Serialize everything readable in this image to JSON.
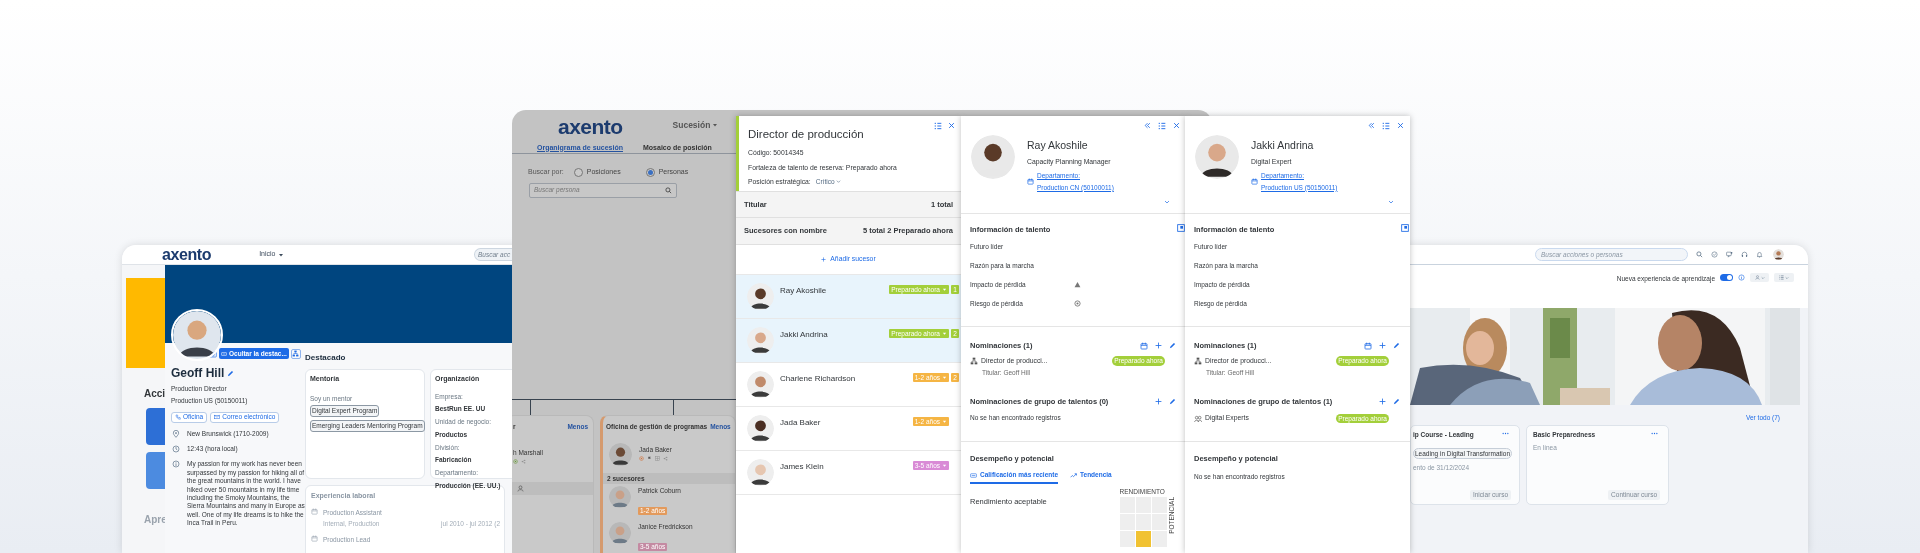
{
  "profile_window": {
    "logo": "axento",
    "nav_menu": "Inicio",
    "search_placeholder": "Buscar acc",
    "side_headings": [
      "Acci",
      "Apre"
    ],
    "profile": {
      "name": "Geoff Hill",
      "title": "Production Director",
      "org": "Production US (50150011)",
      "highlight_button": "Ocultar la destac...",
      "contact_buttons": [
        {
          "kind": "phone",
          "label": "Oficina"
        },
        {
          "kind": "mail",
          "label": "Correo electrónico"
        }
      ],
      "details": [
        {
          "kind": "location",
          "text": "New Brunswick (1710-2009)"
        },
        {
          "kind": "clock",
          "text": "12:43 (hora local)"
        },
        {
          "kind": "info",
          "text": "My passion for my work has never been surpassed by my passion for hiking all of the great mountains in the world. I have hiked over 50 mountains in my life time including the Smoky Mountains, the Sierra Mountains and many in Europe as well. One of my life dreams is to hike the Inca Trail in Peru."
        }
      ]
    },
    "featured": {
      "title": "Destacado",
      "mentoring": {
        "title": "Mentoría",
        "label": "Soy un mentor",
        "programs": [
          "Digital Expert Program",
          "Emerging Leaders Mentoring Program"
        ]
      },
      "organization": {
        "title": "Organización",
        "fields": [
          {
            "label": "Empresa:",
            "value": "BestRun EE. UU"
          },
          {
            "label": "Unidad de negocio:",
            "value": "Productos"
          },
          {
            "label": "División:",
            "value": "Fabricación"
          },
          {
            "label": "Departamento:",
            "value": "Producción (EE. UU.)"
          }
        ]
      },
      "experience": {
        "title": "Experiencia laboral",
        "items": [
          {
            "title": "Production Assistant",
            "subtitle": "Internal, Production",
            "dates": "jul 2010 - jul 2012 (2"
          },
          {
            "title": "Production Lead"
          }
        ]
      }
    }
  },
  "succession_window": {
    "logo": "axento",
    "nav_menu": "Sucesión",
    "tabs": [
      {
        "label": "Organigrama de sucesión",
        "selected": true
      },
      {
        "label": "Mosaico de posición",
        "selected": false
      }
    ],
    "search_by": "Buscar por:",
    "search_options": [
      {
        "label": "Posiciones",
        "selected": false
      },
      {
        "label": "Personas",
        "selected": true
      }
    ],
    "search_placeholder": "Buscar persona",
    "org_cards": [
      {
        "title": "r",
        "link": "Menos",
        "holder": "h Marshall"
      },
      {
        "title": "Oficina de gestión de programas",
        "link": "Menos",
        "holder": "Jada Baker",
        "successor_count": "2 sucesores",
        "successors": [
          {
            "name": "Patrick Coburn",
            "readiness": "1-2 años",
            "color": "#e39a5c"
          },
          {
            "name": "Janice Fredrickson",
            "readiness": "3-5 años",
            "color": "#c48aa2"
          }
        ]
      }
    ]
  },
  "position_panel": {
    "title": "Director de producción",
    "code": "Código: 50014345",
    "bench_strength": "Fortaleza de talento de reserva: Preparado ahora",
    "strategic_label": "Posición estratégica:",
    "strategic_value": "Crítico",
    "incumbent": {
      "label": "Titular",
      "count": "1 total"
    },
    "successors_header": {
      "label": "Sucesores con nombre",
      "count": "5 total 2 Preparado ahora"
    },
    "add_successor": "Añadir sucesor",
    "successors": [
      {
        "name": "Ray Akoshile",
        "readiness": "Preparado ahora",
        "color": "#a3cf3a",
        "rank": "1",
        "selected": true
      },
      {
        "name": "Jakki Andrina",
        "readiness": "Preparado ahora",
        "color": "#a3cf3a",
        "rank": "2",
        "selected": true
      },
      {
        "name": "Charlene Richardson",
        "readiness": "1-2 años",
        "color": "#f5b544",
        "rank": "2",
        "selected": false
      },
      {
        "name": "Jada Baker",
        "readiness": "1-2 años",
        "color": "#f5b544",
        "selected": false
      },
      {
        "name": "James Klein",
        "readiness": "3-5 años",
        "color": "#d98bd6",
        "selected": false
      }
    ]
  },
  "candidate_panels": [
    {
      "name": "Ray Akoshile",
      "role": "Capacity Planning Manager",
      "department_label": "Departamento:",
      "department": "Production CN (50100011)",
      "talent_info": {
        "title": "Información de talento",
        "rows": [
          {
            "label": "Futuro líder",
            "kind": "text"
          },
          {
            "label": "Razón para la marcha",
            "kind": "text"
          },
          {
            "label": "Impacto de pérdida",
            "kind": "warning"
          },
          {
            "label": "Riesgo de pérdida",
            "kind": "risk"
          }
        ]
      },
      "nominations": {
        "title": "Nominaciones (1)",
        "items": [
          {
            "position": "Director de producci...",
            "incumbent": "Titular: Geoff Hill",
            "status": "Preparado ahora"
          }
        ]
      },
      "group_nominations": {
        "title": "Nominaciones de grupo de talentos (0)",
        "empty": "No se han encontrado registros"
      },
      "performance": {
        "title": "Desempeño y potencial",
        "tabs": [
          {
            "label": "Calificación más reciente",
            "selected": true
          },
          {
            "label": "Tendencia",
            "selected": false
          }
        ],
        "rating": "Rendimiento aceptable",
        "grid": {
          "x_label": "RENDIMIENTO",
          "y_label": "POTENCIAL",
          "cells": [
            {
              "selected": false
            },
            {
              "selected": false
            },
            {
              "selected": false
            },
            {
              "selected": false
            },
            {
              "selected": false
            },
            {
              "selected": false
            },
            {
              "selected": false
            },
            {
              "selected": true
            },
            {
              "selected": false
            }
          ]
        }
      }
    },
    {
      "name": "Jakki Andrina",
      "role": "Digital Expert",
      "department_label": "Departamento:",
      "department": "Production US (50150011)",
      "talent_info": {
        "title": "Información de talento",
        "rows": [
          {
            "label": "Futuro líder",
            "kind": "text"
          },
          {
            "label": "Razón para la marcha",
            "kind": "text"
          },
          {
            "label": "Impacto de pérdida",
            "kind": "text"
          },
          {
            "label": "Riesgo de pérdida",
            "kind": "text"
          }
        ]
      },
      "nominations": {
        "title": "Nominaciones (1)",
        "items": [
          {
            "position": "Director de producci...",
            "incumbent": "Titular: Geoff Hill",
            "status": "Preparado ahora"
          }
        ]
      },
      "group_nominations": {
        "title": "Nominaciones de grupo de talentos (1)",
        "items": [
          {
            "name": "Digital Experts",
            "status": "Preparado ahora"
          }
        ]
      },
      "performance": {
        "title": "Desempeño y potencial",
        "empty": "No se han encontrado registros"
      }
    }
  ],
  "learning_window": {
    "search_placeholder": "Buscar acciones o personas",
    "learning_toggle": {
      "label": "Nueva experiencia de aprendizaje",
      "on": true
    },
    "view_all": "Ver todo (7)",
    "courses": [
      {
        "title": "ip Course - Leading",
        "tag": "Leading in Digital Transformation",
        "due": "ento de 31/12/2024",
        "action": "Iniciar curso"
      },
      {
        "title": "Basic Preparedness",
        "format": "En línea",
        "action": "Continuar curso"
      }
    ]
  }
}
